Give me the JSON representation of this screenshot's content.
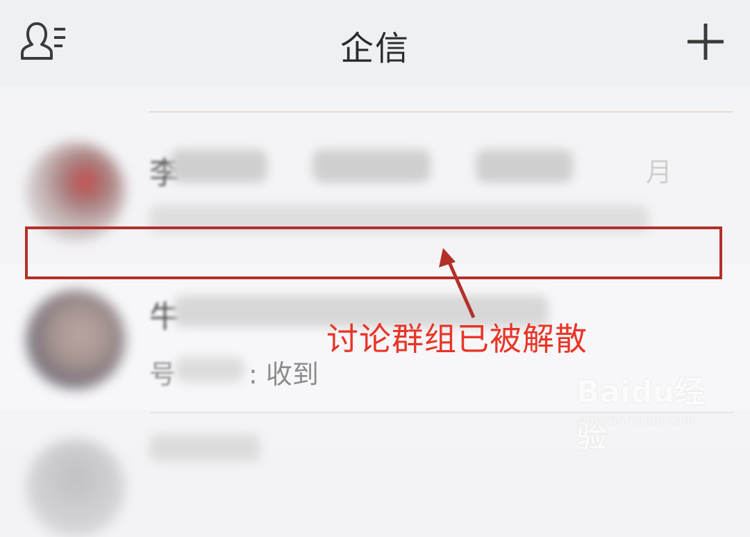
{
  "header": {
    "title": "企信",
    "left_icon": "contacts-list-icon",
    "right_icon": "plus-icon"
  },
  "conversations": [
    {
      "name_first_char": "李",
      "time": "月",
      "preview": ""
    },
    {
      "name_first_char": "牛",
      "time": "",
      "preview_prefix": "号",
      "preview": ": 收到"
    }
  ],
  "annotation": {
    "text": "讨论群组已被解散",
    "color": "#e83528",
    "box_color": "#b3302a"
  },
  "watermark": {
    "logo": "Baidu经验",
    "url": "jingyan.baidu.com"
  }
}
